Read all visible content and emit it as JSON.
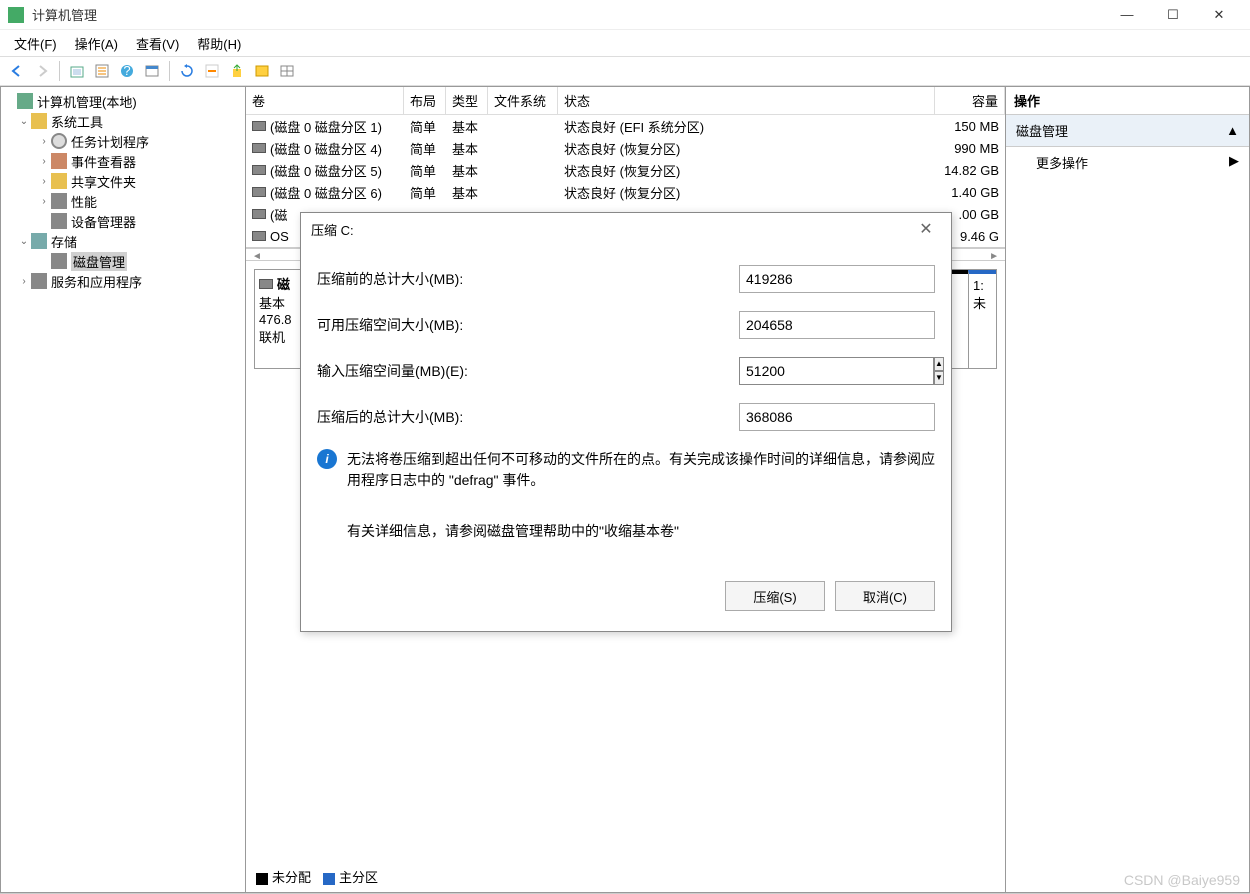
{
  "window": {
    "title": "计算机管理"
  },
  "menu": {
    "file": "文件(F)",
    "action": "操作(A)",
    "view": "查看(V)",
    "help": "帮助(H)"
  },
  "tree": {
    "root": "计算机管理(本地)",
    "system_tools": "系统工具",
    "task_scheduler": "任务计划程序",
    "event_viewer": "事件查看器",
    "shared_folders": "共享文件夹",
    "performance": "性能",
    "device_manager": "设备管理器",
    "storage": "存储",
    "disk_management": "磁盘管理",
    "services": "服务和应用程序"
  },
  "vol_headers": {
    "volume": "卷",
    "layout": "布局",
    "type": "类型",
    "filesystem": "文件系统",
    "status": "状态",
    "capacity": "容量"
  },
  "volumes": [
    {
      "name": "(磁盘 0 磁盘分区 1)",
      "layout": "简单",
      "type": "基本",
      "fs": "",
      "status": "状态良好 (EFI 系统分区)",
      "cap": "150 MB"
    },
    {
      "name": "(磁盘 0 磁盘分区 4)",
      "layout": "简单",
      "type": "基本",
      "fs": "",
      "status": "状态良好 (恢复分区)",
      "cap": "990 MB"
    },
    {
      "name": "(磁盘 0 磁盘分区 5)",
      "layout": "简单",
      "type": "基本",
      "fs": "",
      "status": "状态良好 (恢复分区)",
      "cap": "14.82 GB"
    },
    {
      "name": "(磁盘 0 磁盘分区 6)",
      "layout": "简单",
      "type": "基本",
      "fs": "",
      "status": "状态良好 (恢复分区)",
      "cap": "1.40 GB"
    },
    {
      "name": "(磁",
      "layout": "",
      "type": "",
      "fs": "",
      "status": "",
      "cap": ".00 GB"
    },
    {
      "name": "OS",
      "layout": "",
      "type": "",
      "fs": "",
      "status": "",
      "cap": "9.46 G"
    }
  ],
  "disk_info": {
    "label": "磁",
    "type": "基本",
    "size": "476.8",
    "status": "联机",
    "part_label1": "1:",
    "part_label2": "未"
  },
  "legend": {
    "unallocated": "未分配",
    "primary": "主分区"
  },
  "action_pane": {
    "header": "操作",
    "section": "磁盘管理",
    "more": "更多操作"
  },
  "dialog": {
    "title": "压缩 C:",
    "total_before_label": "压缩前的总计大小(MB):",
    "total_before_value": "419286",
    "available_label": "可用压缩空间大小(MB):",
    "available_value": "204658",
    "input_label": "输入压缩空间量(MB)(E):",
    "input_value": "51200",
    "total_after_label": "压缩后的总计大小(MB):",
    "total_after_value": "368086",
    "info_text": "无法将卷压缩到超出任何不可移动的文件所在的点。有关完成该操作时间的详细信息，请参阅应用程序日志中的 \"defrag\" 事件。",
    "help_text": "有关详细信息，请参阅磁盘管理帮助中的\"收缩基本卷\"",
    "shrink_btn": "压缩(S)",
    "cancel_btn": "取消(C)"
  },
  "watermark": "CSDN @Baiye959"
}
